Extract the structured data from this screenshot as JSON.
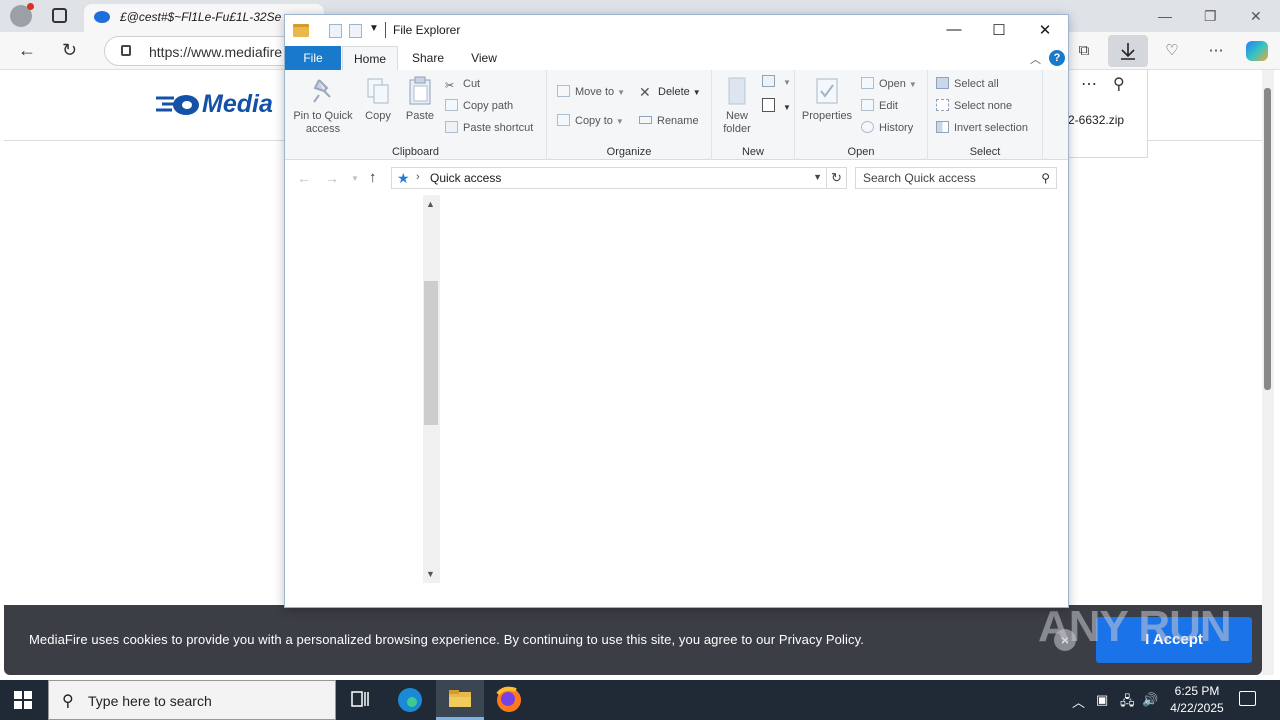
{
  "browser": {
    "tab_title": "£@cest#$~Fl1Le-Fu£1L-32Se",
    "url": "https://www.mediafire",
    "page_logo": "Media",
    "download_filename": "2-6632.zip",
    "cookie_text": "MediaFire uses cookies to provide you with a personalized browsing experience. By continuing to use this site, you agree to our Privacy Policy.",
    "accept_label": "I Accept",
    "watermark": "ANY RUN"
  },
  "explorer": {
    "title": "File Explorer",
    "tabs": {
      "file": "File",
      "home": "Home",
      "share": "Share",
      "view": "View"
    },
    "clipboard": {
      "label": "Clipboard",
      "pin": "Pin to Quick access",
      "copy": "Copy",
      "paste": "Paste",
      "cut": "Cut",
      "copy_path": "Copy path",
      "paste_shortcut": "Paste shortcut"
    },
    "organize": {
      "label": "Organize",
      "move_to": "Move to",
      "copy_to": "Copy to",
      "delete": "Delete",
      "rename": "Rename"
    },
    "new": {
      "label": "New",
      "new_folder": "New folder"
    },
    "open": {
      "label": "Open",
      "properties": "Properties",
      "open": "Open",
      "edit": "Edit",
      "history": "History"
    },
    "select": {
      "label": "Select",
      "select_all": "Select all",
      "select_none": "Select none",
      "invert": "Invert selection"
    },
    "location": "Quick access",
    "search_placeholder": "Search Quick access"
  },
  "taskbar": {
    "search_placeholder": "Type here to search",
    "time": "6:25 PM",
    "date": "4/22/2025"
  },
  "colors": {
    "file_tab": "#1979ca",
    "accept_button": "#1a73e8",
    "cookie_bg": "#3b3e44",
    "taskbar_bg": "#1f2a36"
  }
}
